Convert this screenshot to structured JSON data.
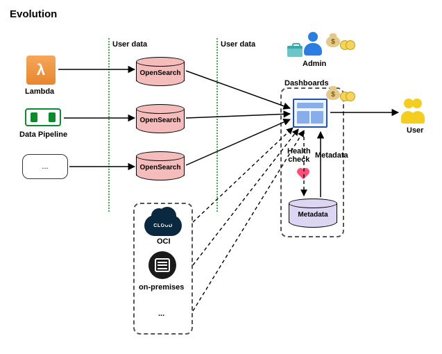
{
  "title": "Evolution",
  "boundaries": {
    "left_label": "User data",
    "right_label": "User data"
  },
  "sources": {
    "lambda": {
      "label": "Lambda"
    },
    "pipeline": {
      "label": "Data Pipeline"
    },
    "other": {
      "label": "..."
    }
  },
  "opensearch": {
    "labels": [
      "OpenSearch",
      "OpenSearch",
      "OpenSearch"
    ]
  },
  "alt_sources": {
    "cloud_badge": "CLOUD",
    "oci_label": "OCI",
    "onprem_label": "on-premises",
    "other_label": "..."
  },
  "dashboards": {
    "group_label": "Dashboards",
    "health_label": "Health\ncheck",
    "metadata_edge_label": "Metadata",
    "metadata_db_label": "Metadata"
  },
  "actors": {
    "admin_label": "Admin",
    "user_label": "User"
  },
  "icons": {
    "money": "$"
  }
}
